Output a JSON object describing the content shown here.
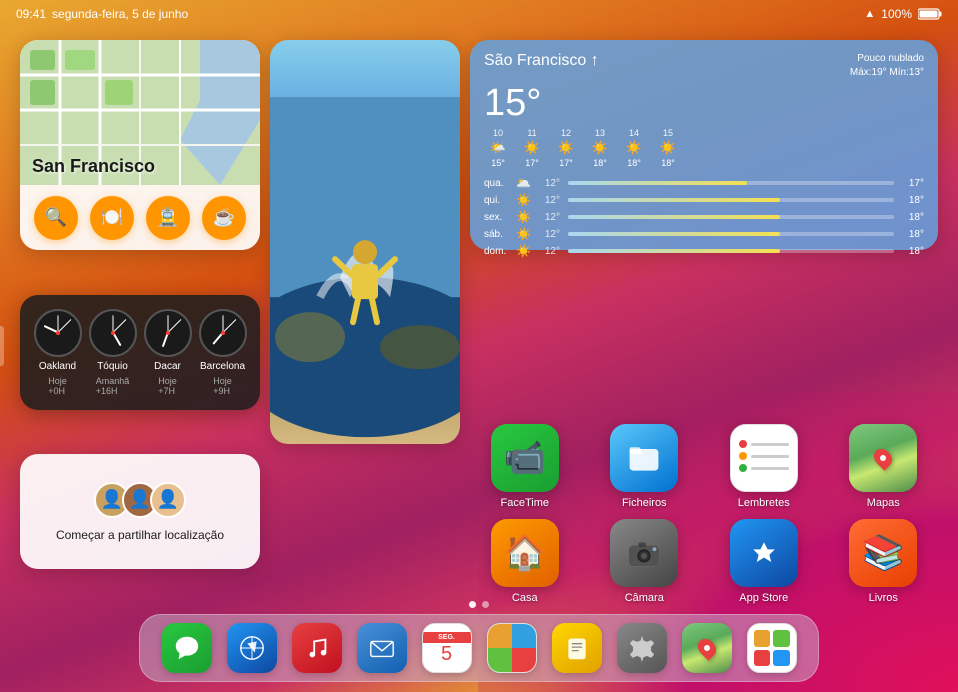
{
  "statusBar": {
    "time": "09:41",
    "date": "segunda-feira, 5 de junho",
    "wifi": "WiFi",
    "battery": "100%"
  },
  "mapsWidget": {
    "title": "San Francisco",
    "buttons": [
      {
        "icon": "🔍",
        "label": "search"
      },
      {
        "icon": "🍽️",
        "label": "food"
      },
      {
        "icon": "🚊",
        "label": "transit"
      },
      {
        "icon": "☕",
        "label": "coffee"
      }
    ]
  },
  "weatherWidget": {
    "city": "São Francisco",
    "location_icon": "↑",
    "condition": "Pouco nublado",
    "hi_lo": "Máx:19° Mín:13°",
    "temp": "15°",
    "hourly": [
      {
        "time": "10",
        "icon": "🌤️",
        "temp": "15°"
      },
      {
        "time": "11",
        "icon": "☀️",
        "temp": "17°"
      },
      {
        "time": "12",
        "icon": "☀️",
        "temp": "17°"
      },
      {
        "time": "13",
        "icon": "☀️",
        "temp": "18°"
      },
      {
        "time": "14",
        "icon": "☀️",
        "temp": "18°"
      },
      {
        "time": "15",
        "icon": "☀️",
        "temp": "18°"
      }
    ],
    "forecast": [
      {
        "day": "qua.",
        "icon": "🌥️",
        "lo": "12°",
        "hi": "17°",
        "fill": 55
      },
      {
        "day": "qui.",
        "icon": "☀️",
        "lo": "12°",
        "hi": "18°",
        "fill": 65
      },
      {
        "day": "sex.",
        "icon": "☀️",
        "lo": "12°",
        "hi": "18°",
        "fill": 65
      },
      {
        "day": "sáb.",
        "icon": "☀️",
        "lo": "12°",
        "hi": "18°",
        "fill": 65
      },
      {
        "day": "dom.",
        "icon": "☀️",
        "lo": "12°",
        "hi": "18°",
        "fill": 65
      }
    ]
  },
  "clockWidget": {
    "clocks": [
      {
        "city": "Oakland",
        "label": "Hoje\n+0H",
        "hour_angle": 290,
        "min_angle": 45
      },
      {
        "city": "Tóquio",
        "label": "Amanhã\n+16H",
        "hour_angle": 150,
        "min_angle": 45
      },
      {
        "city": "Dacar",
        "label": "Hoje\n+7H",
        "hour_angle": 200,
        "min_angle": 45
      },
      {
        "city": "Barcelona",
        "label": "Hoje\n+9H",
        "hour_angle": 220,
        "min_angle": 45
      }
    ]
  },
  "locationWidget": {
    "text": "Começar a partilhar localização"
  },
  "apps": [
    {
      "id": "facetime",
      "label": "FaceTime",
      "icon": "📹",
      "style": "app-facetime"
    },
    {
      "id": "files",
      "label": "Ficheiros",
      "icon": "📁",
      "style": "app-files"
    },
    {
      "id": "reminders",
      "label": "Lembretes",
      "icon": "list",
      "style": "app-reminders"
    },
    {
      "id": "maps",
      "label": "Mapas",
      "icon": "pin",
      "style": "app-maps-icon"
    },
    {
      "id": "home",
      "label": "Casa",
      "icon": "🏠",
      "style": "app-home"
    },
    {
      "id": "camera",
      "label": "Câmara",
      "icon": "📷",
      "style": "app-camera"
    },
    {
      "id": "appstore",
      "label": "App Store",
      "icon": "🅰️",
      "style": "app-appstore"
    },
    {
      "id": "books",
      "label": "Livros",
      "icon": "📖",
      "style": "app-books"
    }
  ],
  "dock": {
    "apps": [
      {
        "id": "messages",
        "style": "dock-messages",
        "icon": "💬"
      },
      {
        "id": "safari",
        "style": "dock-safari",
        "icon": "🧭"
      },
      {
        "id": "music",
        "style": "dock-music",
        "icon": "🎵"
      },
      {
        "id": "mail",
        "style": "dock-mail",
        "icon": "✉️"
      },
      {
        "id": "calendar",
        "style": "dock-calendar",
        "icon": "cal",
        "date_label": "SEG.",
        "date_num": "5"
      },
      {
        "id": "photos",
        "style": "dock-photos",
        "icon": "photos"
      },
      {
        "id": "notes",
        "style": "dock-notes",
        "icon": "📝"
      },
      {
        "id": "settings",
        "style": "dock-settings",
        "icon": "gear"
      },
      {
        "id": "maps-dock",
        "style": "dock-maps",
        "icon": "🗺️"
      },
      {
        "id": "multitask",
        "style": "dock-multitask",
        "icon": "multi"
      }
    ]
  },
  "pageIndicators": [
    true,
    false
  ],
  "strings": {
    "oakland_label": "Oakland",
    "oakland_sub": "Hoje +0H",
    "tokyo_label": "Tóquio",
    "tokyo_sub": "Amanhã +16H",
    "dakar_label": "Dacar",
    "dakar_sub": "Hoje +7H",
    "barcelona_label": "Barcelona",
    "barcelona_sub": "Hoje +9H"
  }
}
